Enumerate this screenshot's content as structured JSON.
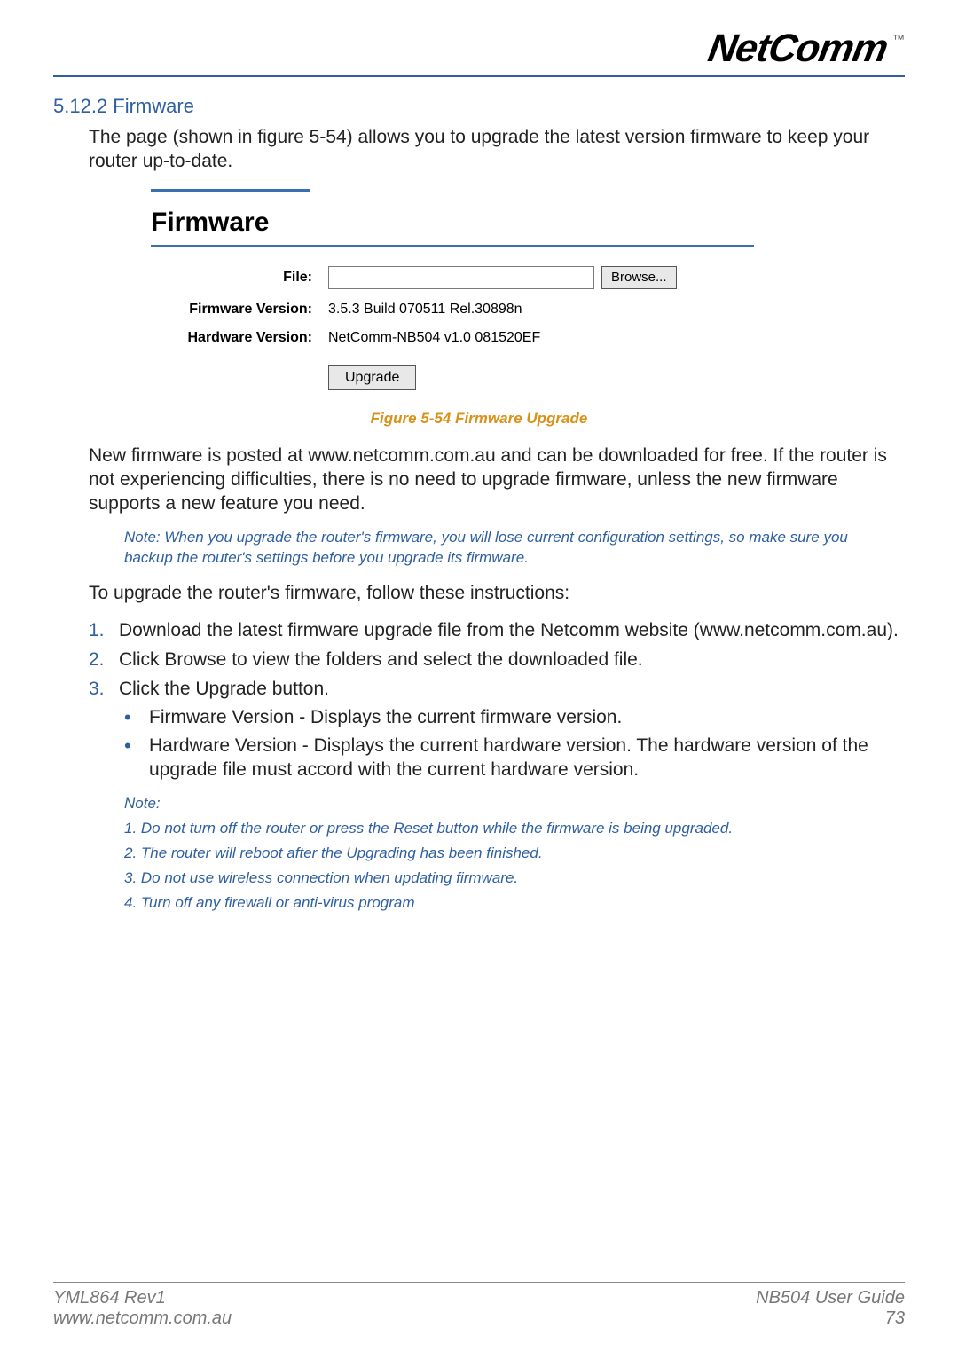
{
  "brand": {
    "logo_text": "NetComm",
    "tm": "™"
  },
  "heading": "5.12.2 Firmware",
  "intro": "The page (shown in figure 5-54) allows you to upgrade the latest version firmware to keep your router up-to-date.",
  "figure": {
    "title": "Firmware",
    "rows": {
      "file_label": "File:",
      "file_value": "",
      "browse_label": "Browse...",
      "fw_label": "Firmware Version:",
      "fw_value": "3.5.3 Build 070511 Rel.30898n",
      "hw_label": "Hardware Version:",
      "hw_value": "NetComm-NB504 v1.0 081520EF"
    },
    "upgrade_label": "Upgrade",
    "caption": "Figure 5-54 Firmware Upgrade"
  },
  "para_after_fig": "New firmware is posted at www.netcomm.com.au and can be downloaded for free. If the router is not experiencing difficulties, there is no need to upgrade firmware, unless the new firmware supports a new feature you need.",
  "note_backup": "Note: When you upgrade the router's firmware, you will lose current configuration settings, so make sure you backup the router's settings before you upgrade its firmware.",
  "instructions_lead": "To upgrade the router's firmware, follow these instructions:",
  "steps": [
    "Download the latest firmware upgrade file from the Netcomm website (www.netcomm.com.au).",
    "Click Browse to view the folders and select the downloaded file.",
    "Click the Upgrade button."
  ],
  "bullets": [
    "Firmware Version - Displays the current firmware version.",
    "Hardware Version - Displays the current hardware version. The hardware version of the upgrade file must accord with the current hardware version."
  ],
  "note_header": "Note:",
  "notes": [
    "1.  Do not turn off the router or press the Reset button while the firmware is being upgraded.",
    "2.  The router will reboot after the Upgrading has been finished.",
    "3.  Do not use wireless connection when updating firmware.",
    "4.  Turn off any firewall or anti-virus program"
  ],
  "footer": {
    "left1": "YML864 Rev1",
    "left2": "www.netcomm.com.au",
    "right1": "NB504 User Guide",
    "right2": "73"
  }
}
